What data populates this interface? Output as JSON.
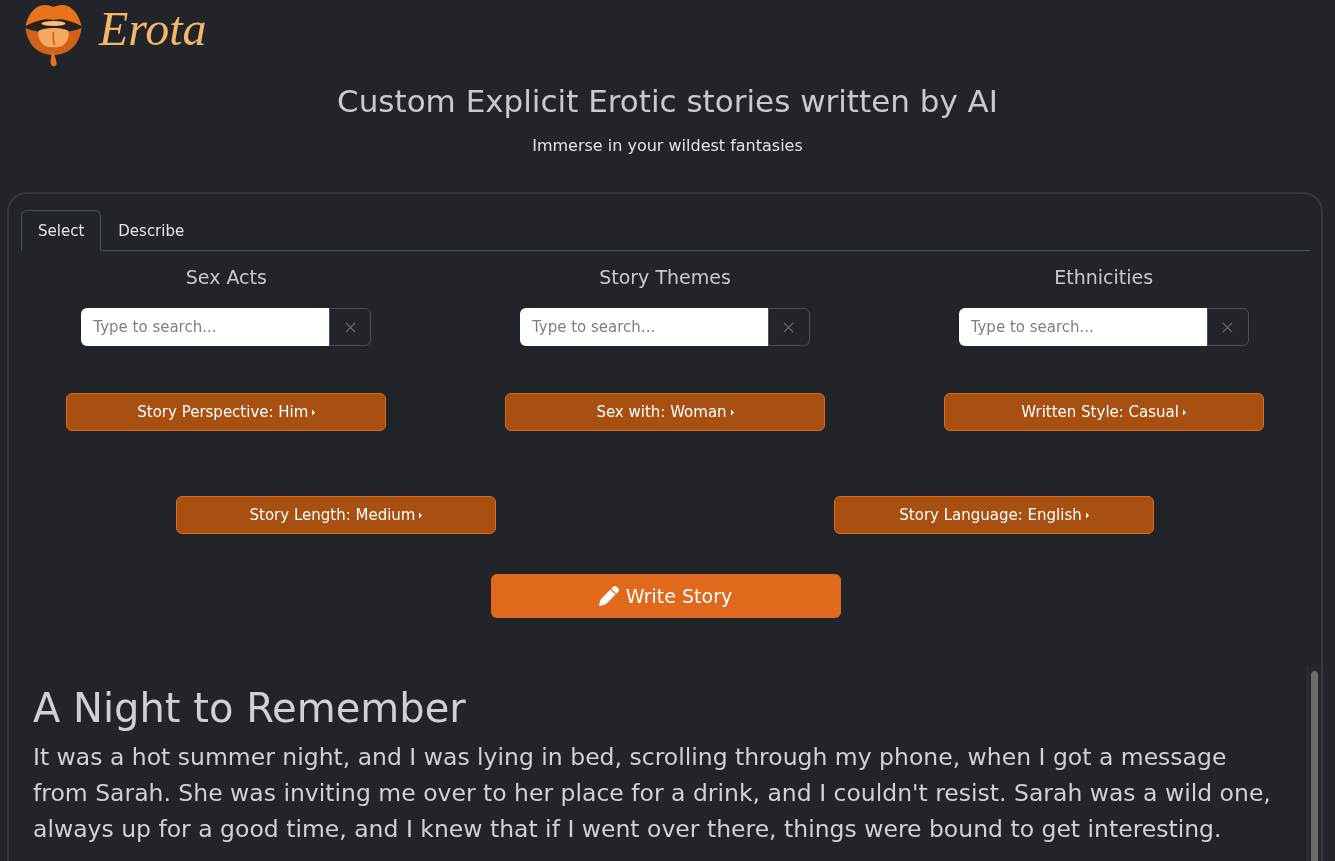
{
  "header": {
    "logo_text": "Erota",
    "title": "Custom Explicit Erotic stories written by AI",
    "subtitle": "Immerse in your wildest fantasies"
  },
  "tabs": [
    {
      "label": "Select",
      "selected": true
    },
    {
      "label": "Describe",
      "selected": false
    }
  ],
  "filters": [
    {
      "heading": "Sex Acts",
      "placeholder": "Type to search..."
    },
    {
      "heading": "Story Themes",
      "placeholder": "Type to search..."
    },
    {
      "heading": "Ethnicities",
      "placeholder": "Type to search..."
    }
  ],
  "option_rows": [
    [
      {
        "label": "Story Perspective: Him"
      },
      {
        "label": "Sex with: Woman"
      },
      {
        "label": "Written Style: Casual"
      }
    ],
    [
      {
        "label": "Story Length: Medium"
      },
      {
        "label": "Story Language: English"
      }
    ]
  ],
  "write_button": {
    "label": "Write Story"
  },
  "story": {
    "title": "A Night to Remember",
    "body": "It was a hot summer night, and I was lying in bed, scrolling through my phone, when I got a message from Sarah. She was inviting me over to her place for a drink, and I couldn't resist. Sarah was a wild one, always up for a good time, and I knew that if I went over there, things were bound to get interesting."
  }
}
